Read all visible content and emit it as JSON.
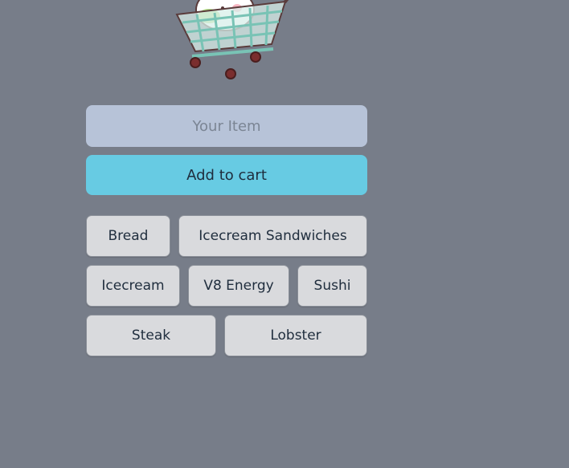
{
  "header": {
    "illustration": "cat-in-shopping-cart"
  },
  "form": {
    "input_placeholder": "Your Item",
    "input_value": "",
    "add_button_label": "Add to cart"
  },
  "cart": {
    "rows": [
      [
        "Bread",
        "Icecream Sandwiches"
      ],
      [
        "Icecream",
        "V8 Energy",
        "Sushi"
      ],
      [
        "Steak",
        "Lobster"
      ]
    ]
  },
  "colors": {
    "background": "#777d89",
    "input_background": "#b7c3d8",
    "button_background": "#67cbe3",
    "chip_background": "#d9dadd",
    "text": "#1f2d3d"
  }
}
